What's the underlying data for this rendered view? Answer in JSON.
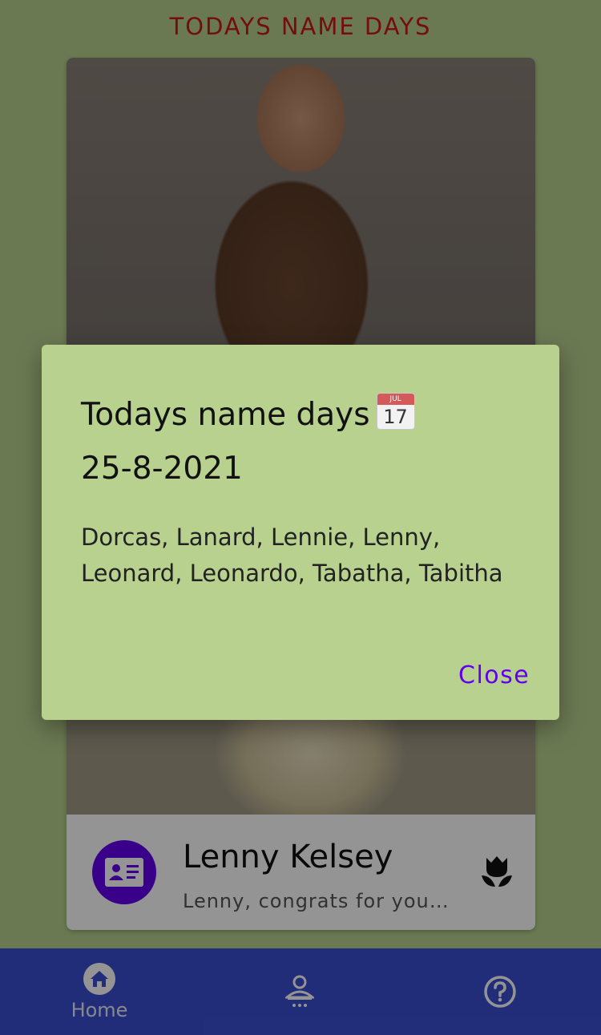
{
  "page": {
    "title": "TODAYS NAME DAYS"
  },
  "card": {
    "name": "Lenny Kelsey",
    "message": "Lenny, congrats for your…",
    "avatar_icon": "contact-card-icon",
    "action_icon": "tulip-icon"
  },
  "dialog": {
    "title": "Todays name days",
    "calendar_icon": {
      "month": "JUL",
      "day": "17"
    },
    "date": "25-8-2021",
    "names": "Dorcas, Lanard, Lennie, Lenny, Leonard, Leonardo, Tabatha, Tabitha",
    "close_label": "Close"
  },
  "bottom_nav": {
    "items": [
      {
        "label": "Home",
        "icon": "home-icon"
      },
      {
        "label": "",
        "icon": "user-icon"
      },
      {
        "label": "",
        "icon": "help-icon"
      }
    ]
  },
  "colors": {
    "background": "#b8d18f",
    "title": "#c6171b",
    "accent": "#6200ee",
    "nav": "#3a4fd1"
  }
}
